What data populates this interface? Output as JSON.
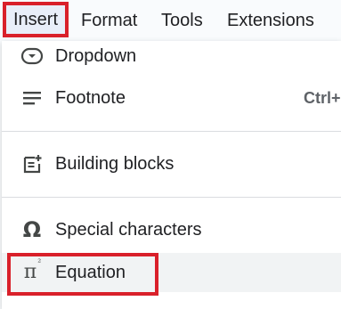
{
  "menubar": {
    "items": [
      {
        "label": "Insert"
      },
      {
        "label": "Format"
      },
      {
        "label": "Tools"
      },
      {
        "label": "Extensions"
      }
    ]
  },
  "menu": {
    "items": [
      {
        "label": "Dropdown",
        "icon": "dropdown-icon"
      },
      {
        "label": "Footnote",
        "icon": "footnote-icon",
        "shortcut": "Ctrl+"
      },
      {
        "label": "Building blocks",
        "icon": "building-blocks-icon"
      },
      {
        "label": "Special characters",
        "icon": "omega-icon",
        "glyph": "Ω"
      },
      {
        "label": "Equation",
        "icon": "pi-squared-icon",
        "glyph": "π",
        "sup": "²"
      }
    ]
  },
  "colors": {
    "highlight_border": "#d9202a",
    "active_menu_bg": "#e8eef9",
    "hover_bg": "#f1f3f4"
  }
}
